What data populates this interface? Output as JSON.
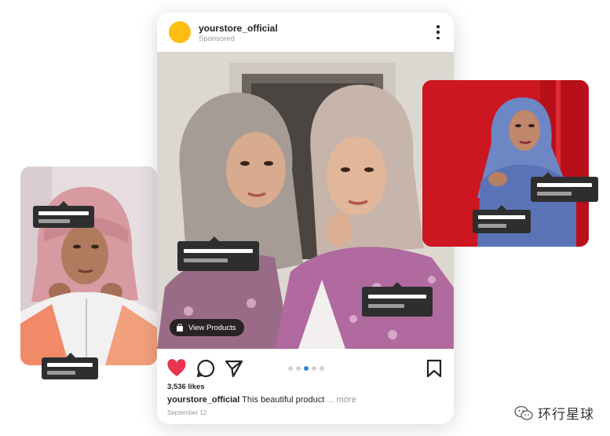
{
  "post": {
    "store_name": "yourstore_official",
    "sponsored_label": "Sponsored",
    "view_products_label": "View Products",
    "likes": "3,536 likes",
    "caption_user": "yourstore_official",
    "caption_text": " This beautiful product ",
    "caption_more": "... more",
    "date": "September 12",
    "carousel": {
      "count": 5,
      "active_index": 2
    },
    "liked": true
  },
  "watermark": {
    "text": "环行星球"
  },
  "icons": {
    "kebab": "more-options-icon",
    "bag": "shopping-bag-icon",
    "like": "heart-icon",
    "comment": "comment-icon",
    "share": "paper-plane-icon",
    "save": "bookmark-icon",
    "watermark": "wechat-icon"
  },
  "colors": {
    "avatar": "#fdbd13",
    "heart": "#e8344d",
    "carousel_active": "#3b82d6",
    "tag_bg": "#2e2e2e",
    "right_backdrop": "#c9141f"
  }
}
